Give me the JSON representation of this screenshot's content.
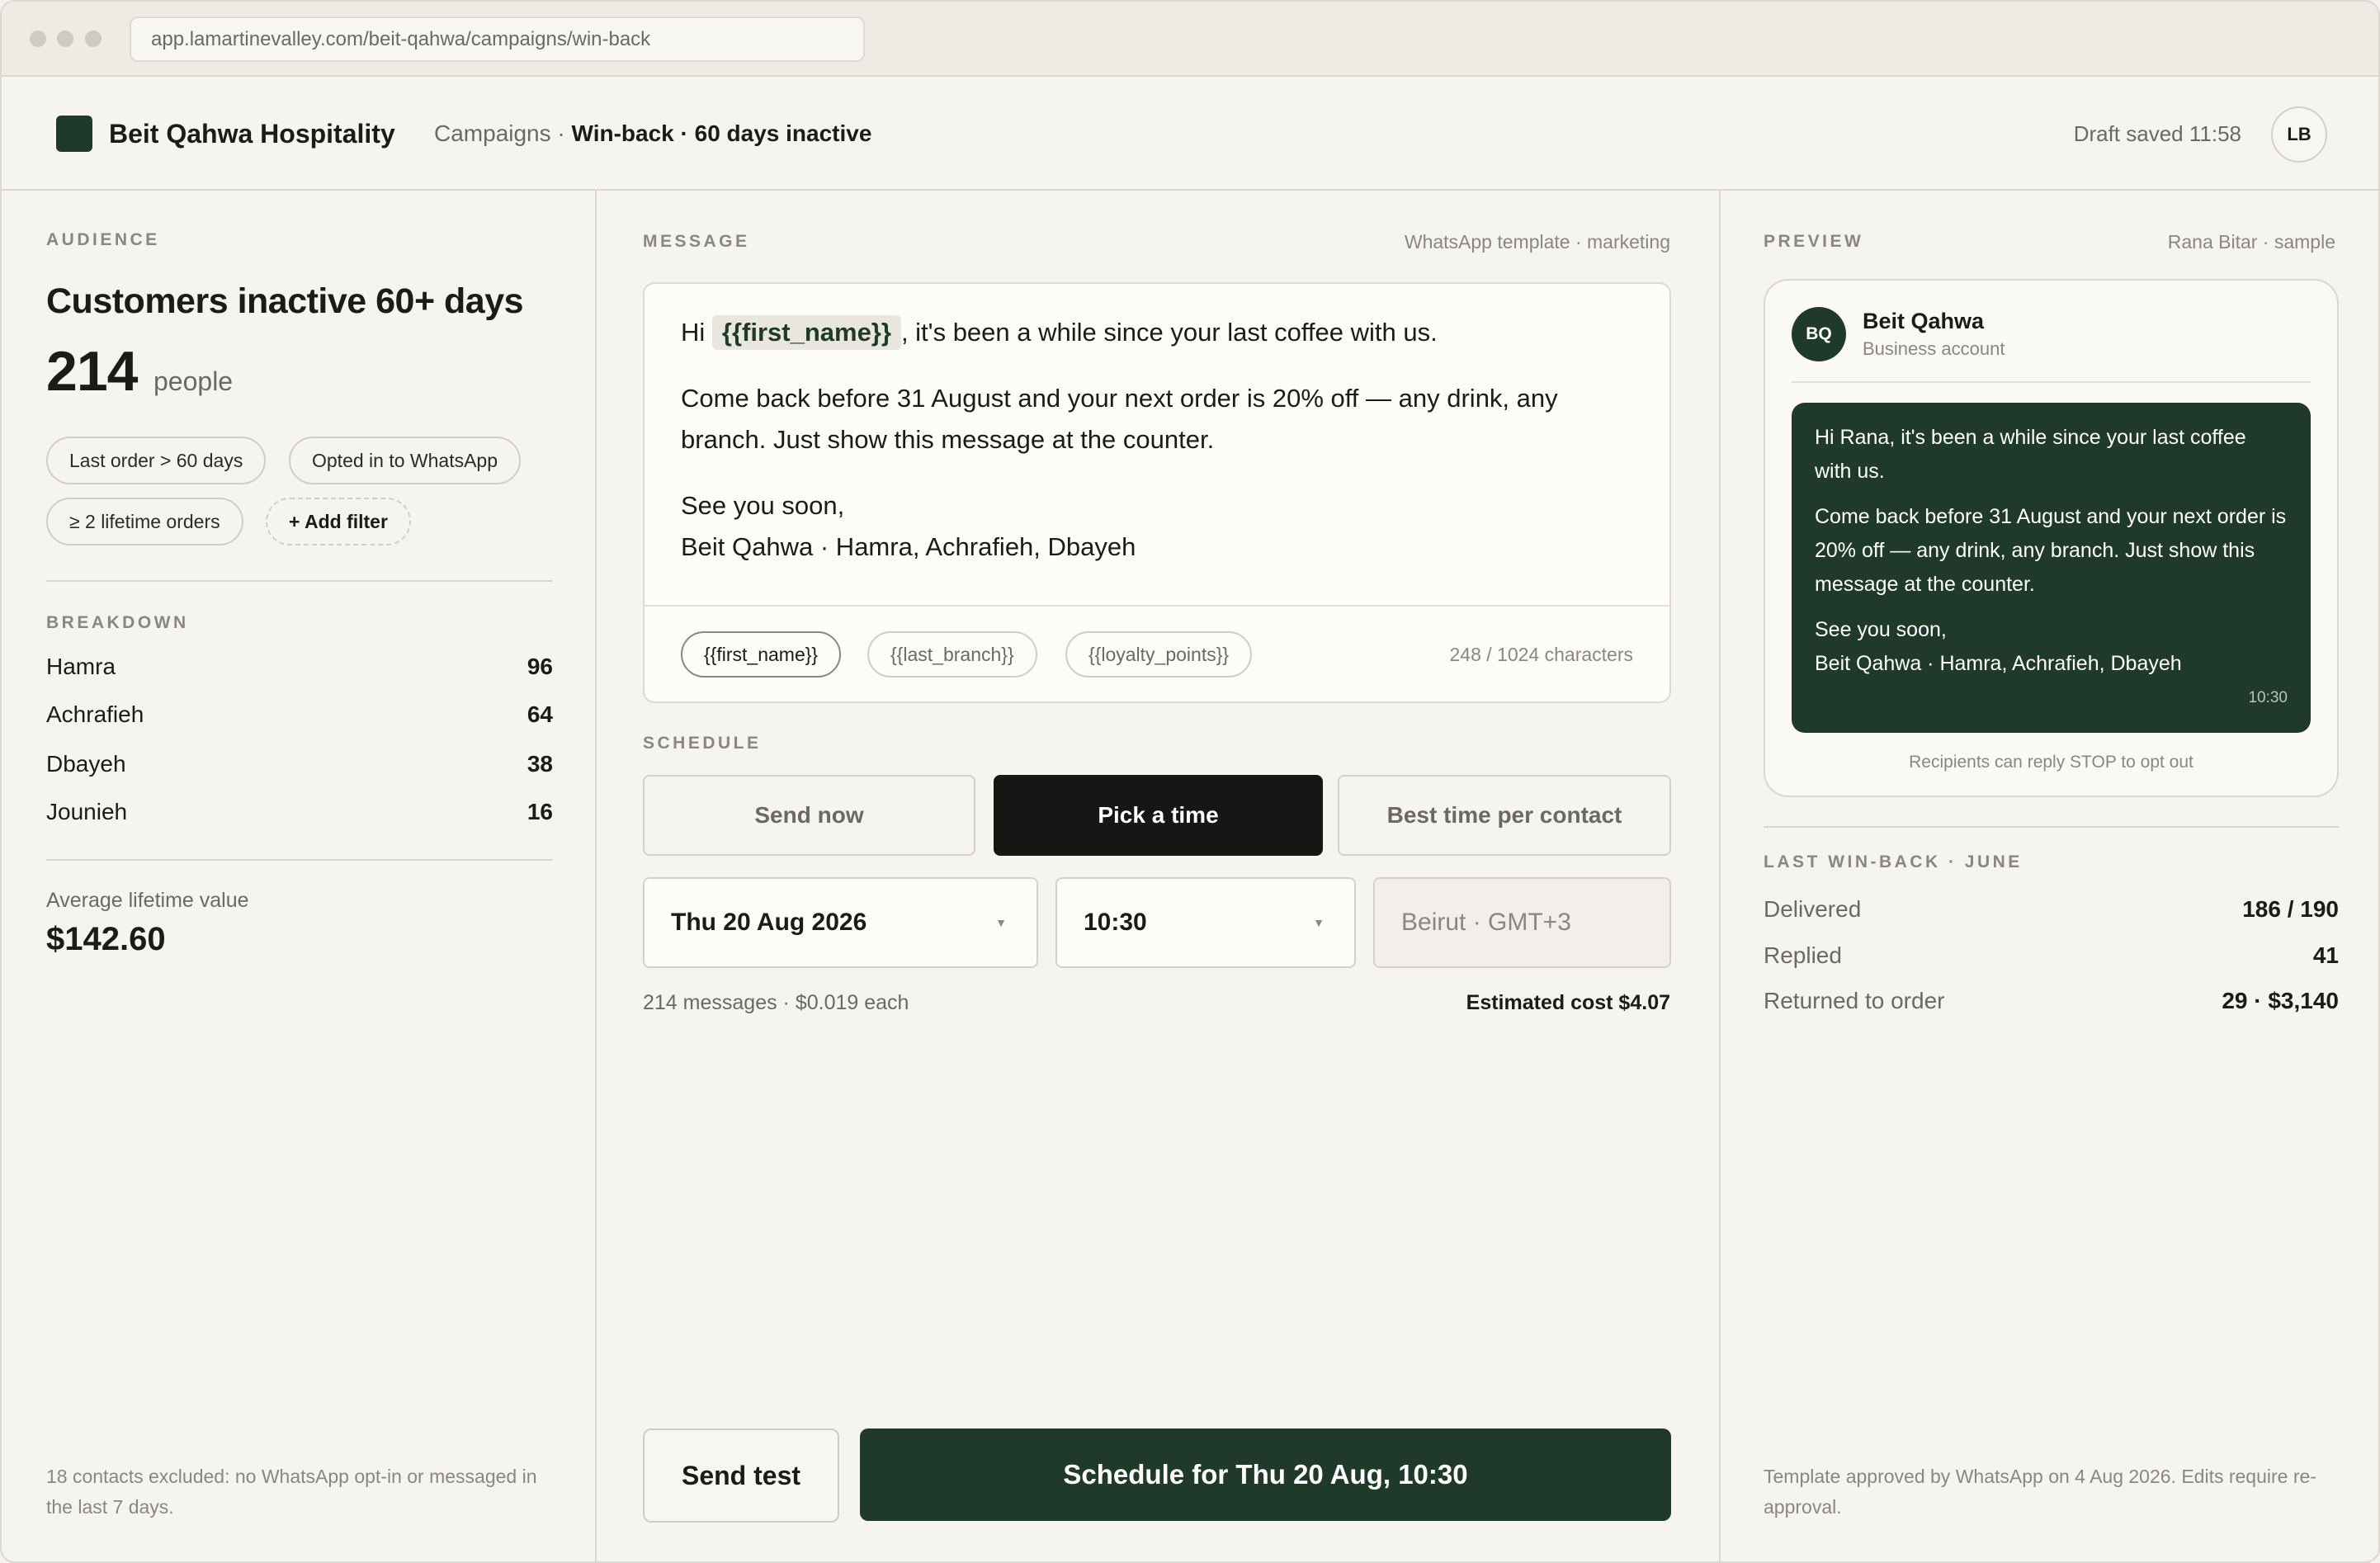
{
  "browser": {
    "url": "app.lamartinevalley.com/beit-qahwa/campaigns/win-back"
  },
  "header": {
    "brand": "Beit Qahwa Hospitality",
    "breadcrumb_root": "Campaigns",
    "breadcrumb_sep": " · ",
    "breadcrumb_current": "Win-back · 60 days inactive",
    "draft_status": "Draft saved 11:58",
    "user_initials": "LB"
  },
  "audience": {
    "section_label": "AUDIENCE",
    "title": "Customers inactive 60+ days",
    "count": "214",
    "count_unit": "people",
    "filters": [
      "Last order > 60 days",
      "Opted in to WhatsApp",
      "≥ 2 lifetime orders"
    ],
    "add_filter": "+ Add filter",
    "breakdown_label": "BREAKDOWN",
    "breakdown": [
      {
        "name": "Hamra",
        "value": "96"
      },
      {
        "name": "Achrafieh",
        "value": "64"
      },
      {
        "name": "Dbayeh",
        "value": "38"
      },
      {
        "name": "Jounieh",
        "value": "16"
      }
    ],
    "avg_label": "Average lifetime value",
    "avg_value": "$142.60",
    "excluded_note": "18 contacts excluded: no WhatsApp opt-in or messaged in the last 7 days."
  },
  "message": {
    "section_label": "MESSAGE",
    "template_type": "WhatsApp template · marketing",
    "line1_prefix": "Hi ",
    "line1_var": "{{first_name}}",
    "line1_suffix": ", it's been a while since your last coffee with us.",
    "line2": "Come back before 31 August and your next order is 20% off — any drink, any branch. Just show this message at the counter.",
    "line3a": "See you soon,",
    "line3b": "Beit Qahwa · Hamra, Achrafieh, Dbayeh",
    "variables": [
      "{{first_name}}",
      "{{last_branch}}",
      "{{loyalty_points}}"
    ],
    "char_count": "248 / 1024 characters"
  },
  "schedule": {
    "section_label": "SCHEDULE",
    "options": [
      "Send now",
      "Pick a time",
      "Best time per contact"
    ],
    "selected_option": "Pick a time",
    "date": "Thu 20 Aug 2026",
    "time": "10:30",
    "timezone": "Beirut · GMT+3",
    "messages_info": "214 messages · $0.019 each",
    "estimated_cost": "Estimated cost $4.07"
  },
  "actions": {
    "send_test": "Send test",
    "schedule": "Schedule for Thu 20 Aug, 10:30"
  },
  "preview": {
    "section_label": "PREVIEW",
    "sample": "Rana Bitar · sample",
    "avatar": "BQ",
    "business_name": "Beit Qahwa",
    "business_sub": "Business account",
    "bubble_p1": "Hi Rana, it's been a while since your last coffee with us.",
    "bubble_p2": "Come back before 31 August and your next order is 20% off — any drink, any branch. Just show this message at the counter.",
    "bubble_p3a": "See you soon,",
    "bubble_p3b": "Beit Qahwa · Hamra, Achrafieh, Dbayeh",
    "bubble_time": "10:30",
    "stop_note": "Recipients can reply STOP to opt out"
  },
  "last_winback": {
    "section_label": "LAST WIN-BACK · JUNE",
    "stats": [
      {
        "label": "Delivered",
        "value": "186 / 190"
      },
      {
        "label": "Replied",
        "value": "41"
      },
      {
        "label": "Returned to order",
        "value": "29 · $3,140"
      }
    ],
    "approval_note": "Template approved by WhatsApp on 4 Aug 2026. Edits require re-approval."
  },
  "colors": {
    "accent": "#1f3a2b",
    "background": "#f6f4ef",
    "selected_segment": "#161614"
  }
}
